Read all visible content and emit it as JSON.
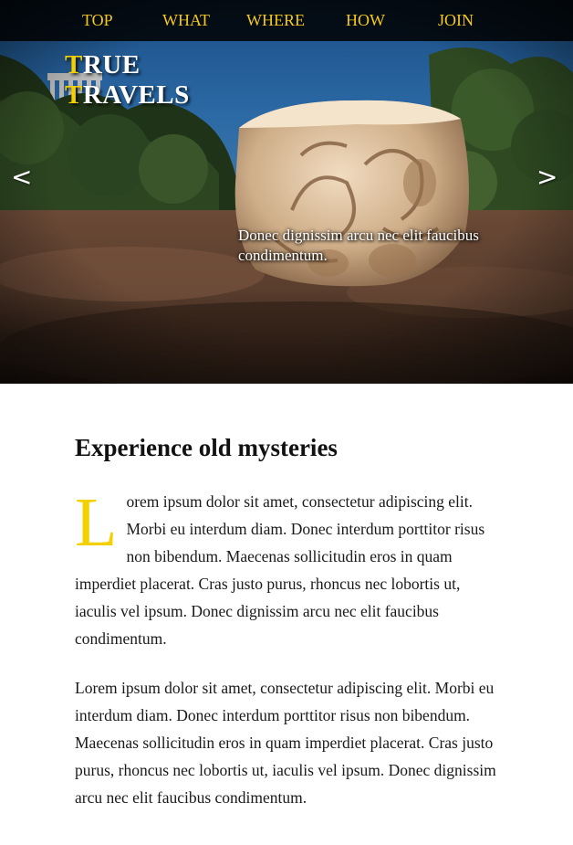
{
  "nav": {
    "items": [
      "TOP",
      "WHAT",
      "WHERE",
      "HOW",
      "JOIN"
    ]
  },
  "logo": {
    "line1_first": "T",
    "line1_rest": "RUE",
    "line2_first": "T",
    "line2_rest": "RAVELS"
  },
  "hero": {
    "prev_label": "<",
    "next_label": ">",
    "caption": "Donec dignissim arcu nec elit faucibus condimentum."
  },
  "article": {
    "title": "Experience old mysteries",
    "dropcap": "L",
    "paragraph1": "orem ipsum dolor sit amet, consectetur adipiscing elit. Morbi eu interdum diam. Donec interdum porttitor risus non bibendum. Maecenas sollicitudin eros in quam imperdiet placerat. Cras justo purus, rhoncus nec lobortis ut, iaculis vel ipsum. Donec dignissim arcu nec elit faucibus condimentum.",
    "paragraph2": "Lorem ipsum dolor sit amet, consectetur adipiscing elit. Morbi eu interdum diam. Donec interdum porttitor risus non bibendum. Maecenas sollicitudin eros in quam imperdiet placerat. Cras justo purus, rhoncus nec lobortis ut, iaculis vel ipsum. Donec dignissim arcu nec elit faucibus condimentum."
  },
  "colors": {
    "accent": "#f5c81a",
    "logo_accent": "#f5d000",
    "nav_background": "#000000",
    "text": "#111111"
  }
}
